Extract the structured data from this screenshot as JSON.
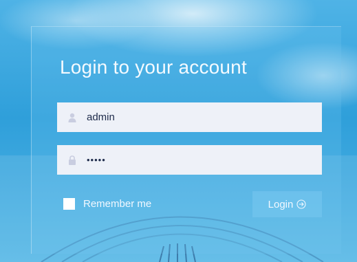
{
  "form": {
    "title": "Login to your account",
    "username": {
      "value": "admin",
      "icon": "user-icon"
    },
    "password": {
      "value": "•••••",
      "icon": "lock-icon"
    },
    "remember_label": "Remember me",
    "remember_checked": false,
    "login_label": "Login",
    "login_icon": "arrow-right-circle-icon"
  },
  "colors": {
    "background": "#2a9cd6",
    "field_bg": "#eef1f8",
    "text_light": "#f4faff",
    "text_dark": "#1d2a4a"
  }
}
